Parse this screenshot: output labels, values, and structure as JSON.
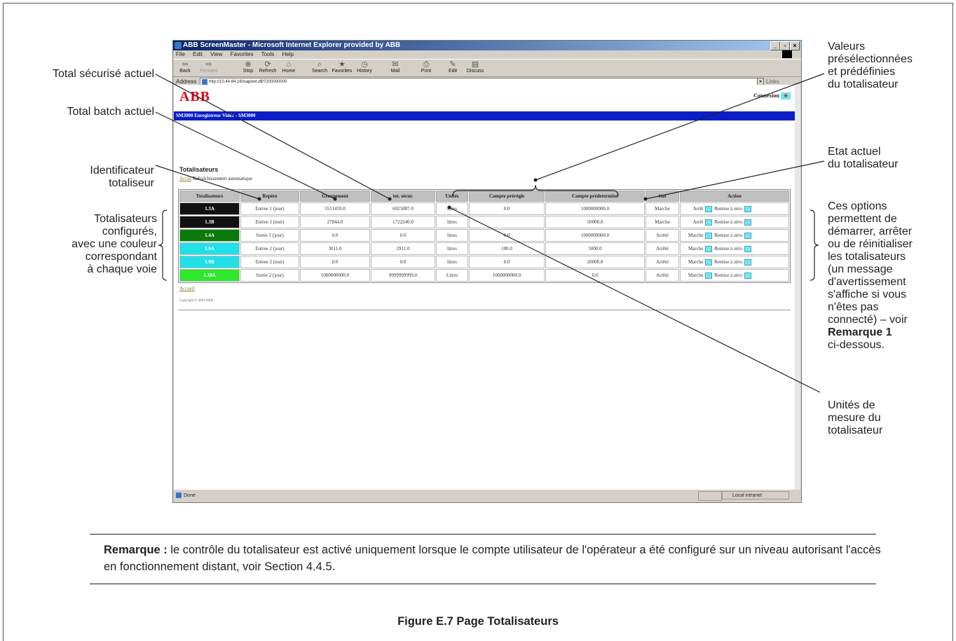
{
  "annotations": {
    "total_securise": "Total sécurisé actuel",
    "total_batch": "Total batch actuel",
    "identificateur": [
      "Identificateur",
      "totaliseur"
    ],
    "configures": [
      "Totalisateurs",
      "configurés,",
      "avec une couleur",
      "correspondant",
      "à chaque voie"
    ],
    "valeurs": [
      "Valeurs",
      "présélectionnées",
      "et prédéfinies",
      "du totalisateur"
    ],
    "etat": [
      "Etat actuel",
      "du totalisateur"
    ],
    "options": [
      "Ces options",
      "permettent de",
      "démarrer, arrêter",
      "ou de réinitialiser",
      "les totalisateurs",
      "(un message",
      "d'avertissement",
      "s'affiche si vous",
      "n'êtes pas",
      "connecté) – voir"
    ],
    "options_bold": "Remarque 1",
    "options_end": "ci-dessous.",
    "unites": [
      "Unités de",
      "mesure du",
      "totalisateur"
    ]
  },
  "browser": {
    "title": "ABB ScreenMaster - Microsoft Internet Explorer provided by ABB",
    "menu": [
      "File",
      "Edit",
      "View",
      "Favorites",
      "Tools",
      "Help"
    ],
    "toolbar": [
      "Back",
      "Forward",
      "Stop",
      "Refresh",
      "Home",
      "Search",
      "Favorites",
      "History",
      "Mail",
      "Print",
      "Edit",
      "Discuss"
    ],
    "address_label": "Address",
    "url": "http://10.44.84.16/isapiext.dll/?200000000",
    "links": "Links",
    "status": "Done",
    "zone": "Local intranet"
  },
  "page": {
    "logo": "ABB",
    "connexion": "Connexion",
    "banner": "SM3000 Enregistreur Vidéo - SM3000",
    "title": "Totalisateurs",
    "link_acces": "Accès",
    "refresh": "Rafraîchissement automatique",
    "accueil": "Accueil",
    "copyright": "Copyright © 2001 ABB"
  },
  "table": {
    "headers": [
      "Totalisateurs",
      "Repère",
      "Groupement",
      "tot. sécur.",
      "Unités",
      "Compte prérégle",
      "Compte prédeterminé",
      "état",
      "Action"
    ],
    "rows": [
      {
        "id": "1.3A",
        "color": "#111111",
        "repere": "Entree 1 (jour)",
        "groupement": "5511459.0",
        "tot": "6925887.0",
        "unites": "litres",
        "preregle": "0.0",
        "predetermine": "1000000000.0",
        "etat": "Marche",
        "action1": "Arrêt",
        "action2": "Remise à zéro"
      },
      {
        "id": "1.3B",
        "color": "#111111",
        "repere": "Entree 1 (nuit)",
        "groupement": "27844.0",
        "tot": "1722240.0",
        "unites": "litres",
        "preregle": "",
        "predetermine": "50000.0",
        "etat": "Marche",
        "action1": "Arrêt",
        "action2": "Remise à zéro"
      },
      {
        "id": "1.4A",
        "color": "#0a7a0a",
        "repere": "Sortie 1 (jour)",
        "groupement": "0.0",
        "tot": "0.0",
        "unites": "litres",
        "preregle": "0.0",
        "predetermine": "1000000000.0",
        "etat": "Arrêté",
        "action1": "Marche",
        "action2": "Remise à zéro"
      },
      {
        "id": "1.9A",
        "color": "#22dfe8",
        "repere": "Entree 2 (jour)",
        "groupement": "3011.0",
        "tot": "2911.0",
        "unites": "litres",
        "preregle": "100.0",
        "predetermine": "5000.0",
        "etat": "Arrêté",
        "action1": "Marche",
        "action2": "Remise à zéro"
      },
      {
        "id": "1.9B",
        "color": "#22dfe8",
        "repere": "Entree 2 (nuit)",
        "groupement": "0.0",
        "tot": "0.0",
        "unites": "litres",
        "preregle": "0.0",
        "predetermine": "20000.0",
        "etat": "Arrêté",
        "action1": "Marche",
        "action2": "Remise à zéro"
      },
      {
        "id": "1.10A",
        "color": "#2ee82e",
        "repere": "Sortie 2 (jour)",
        "groupement": "1000000000.0",
        "tot": "9999999999.0",
        "unites": "Litres",
        "preregle": "1000000000.0",
        "predetermine": "0.0",
        "etat": "Arrêté",
        "action1": "Marche",
        "action2": "Remise à zéro"
      }
    ]
  },
  "note": {
    "label": "Remarque :",
    "text": " le contrôle du totalisateur est activé uniquement lorsque le compte utilisateur de l'opérateur a été configuré sur un niveau autorisant l'accès en fonctionnement distant, voir Section 4.4.5."
  },
  "caption": "Figure E.7 Page Totalisateurs"
}
